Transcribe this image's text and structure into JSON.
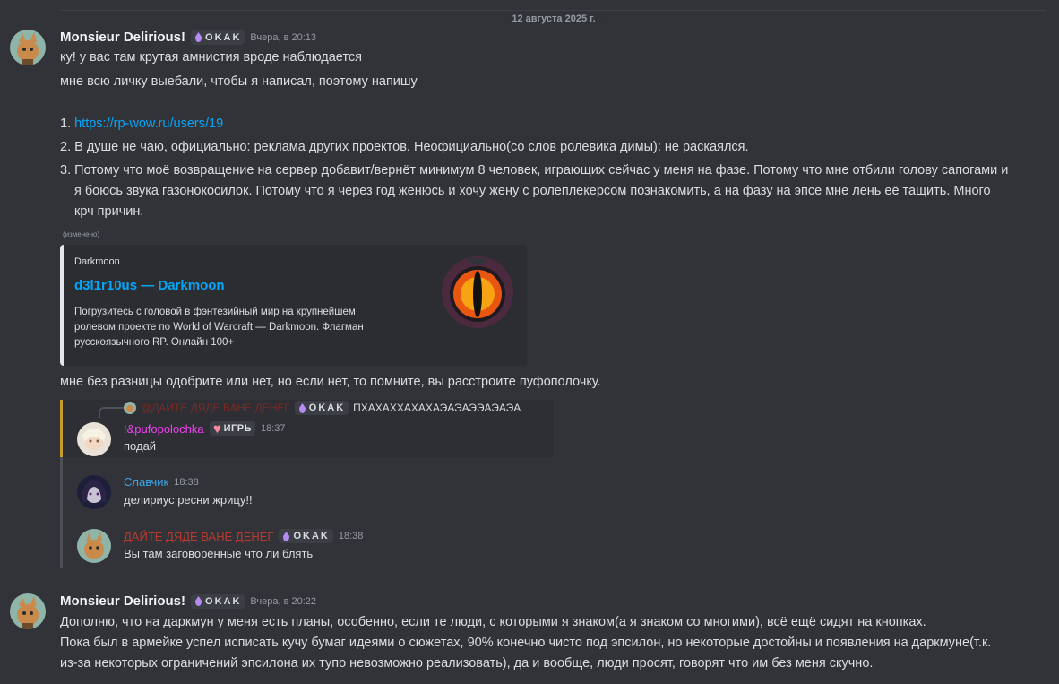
{
  "divider": {
    "date": "12 августа 2025 г."
  },
  "messages": [
    {
      "author": "Monsieur Delirious!",
      "tag": "OKAK",
      "time": "Вчера, в 20:13",
      "lines": [
        "ку! у вас там крутая амнистия вроде наблюдается",
        "мне всю личку выебали, чтобы я написал, поэтому напишу"
      ],
      "list": [
        {
          "num": "1.",
          "text": "https://rp-wow.ru/users/19",
          "is_link": true
        },
        {
          "num": "2.",
          "text": "В душе не чаю, официально: реклама других проектов. Неофициально(со слов ролевика димы): не раскаялся."
        },
        {
          "num": "3.",
          "text_lines": [
            "Потому что моё возвращение на сервер добавит/вернёт минимум 8 человек, играющих сейчас у меня на фазе. Потому что мне отбили голову сапогами и",
            "я боюсь звука газонокосилок. Потому что я через год женюсь и хочу жену с ролеплекерсом познакомить, а на фазу на эпсе мне лень её тащить. Много",
            "крч причин."
          ]
        }
      ],
      "edited": "(изменено)",
      "embed": {
        "provider": "Darkmoon",
        "title": "d3l1r10us — Darkmoon",
        "description_lines": [
          "Погрузитесь с головой в фэнтезийный мир на крупнейшем",
          "ролевом проекте по World of Warcraft — Darkmoon. Флагман",
          "русскоязычного RP. Онлайн 100+"
        ]
      },
      "after_embed": "мне без разницы одобрите или нет, но если нет, то помните, вы расстроите пуфополочку."
    },
    {
      "author": "Monsieur Delirious!",
      "tag": "OKAK",
      "time": "Вчера, в 20:22",
      "lines": [
        "Дополню, что на даркмун у меня есть планы, особенно, если те люди, с которыми я знаком(а я знаком со многими), всё ещё сидят на кнопках.",
        "Пока был в армейке успел исписать кучу бумаг идеями о сюжетах, 90% конечно чисто под эпсилон, но некоторые достойны и появления на даркмуне(т.к.",
        "из-за некоторых ограничений эпсилона их тупо невозможно реализовать), да и вообще, люди просят, говорят что им без меня скучно."
      ]
    }
  ],
  "thread": {
    "reply_ref": {
      "author": "@ДАЙТЕ ДЯДЕ ВАНЕ ДЕНЕГ",
      "tag": "OKAK",
      "text": "ПХАХАХХАХАХАЭАЭАЭЭАЭАЭА"
    },
    "items": [
      {
        "author": "!&pufopolochka",
        "tag": "ИГРЬ",
        "time": "18:37",
        "text": "подай",
        "author_color": "#f23ff2"
      },
      {
        "author": "Славчик",
        "time": "18:38",
        "text": "делириус ресни жрицу!!",
        "author_color": "#3ea6e6"
      },
      {
        "author": "ДАЙТЕ ДЯДЕ ВАНЕ ДЕНЕГ",
        "tag": "OKAK",
        "time": "18:38",
        "text": "Вы там заговорённые что ли блять",
        "author_color": "#b83a2e"
      }
    ]
  }
}
